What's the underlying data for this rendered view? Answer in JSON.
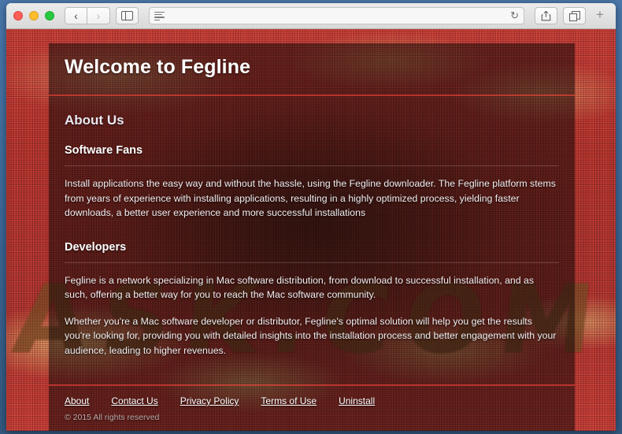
{
  "window": {
    "traffic_lights": [
      "close",
      "minimize",
      "zoom"
    ],
    "nav": {
      "back_label": "‹",
      "forward_label": "›"
    },
    "sidebar_button": "sidebar-toggle",
    "address": {
      "value": "",
      "placeholder": ""
    },
    "reload_label": "↻",
    "share_label": "share",
    "tabs_label": "show-tabs",
    "new_tab_label": "+"
  },
  "page": {
    "title": "Welcome to Fegline",
    "about_heading": "About Us",
    "sections": [
      {
        "title": "Software Fans",
        "paragraphs": [
          "Install applications the easy way and without the hassle, using the Fegline downloader. The Fegline platform stems from years of experience with installing applications, resulting in a highly optimized process, yielding faster downloads, a better user experience and more successful installations"
        ]
      },
      {
        "title": "Developers",
        "paragraphs": [
          "Fegline is a network specializing in Mac software distribution, from download to successful installation, and as such, offering a better way for you to reach the Mac software community.",
          "Whether you're a Mac software developer or distributor, Fegline's optimal solution will help you get the results you're looking for, providing you with detailed insights into the installation process and better engagement with your audience, leading to higher revenues."
        ]
      }
    ],
    "footer": {
      "links": [
        {
          "label": "About"
        },
        {
          "label": "Contact Us"
        },
        {
          "label": "Privacy Policy"
        },
        {
          "label": "Terms of Use"
        },
        {
          "label": "Uninstall"
        }
      ],
      "copyright": "© 2015 All rights reserved"
    },
    "background_word": "ASK.COM"
  },
  "colors": {
    "accent_rule": "#ff463c",
    "panel_overlay": "#160908",
    "fabric_red": "#bf3a37",
    "fabric_gold": "#e2ba76",
    "text": "#ffffff"
  }
}
